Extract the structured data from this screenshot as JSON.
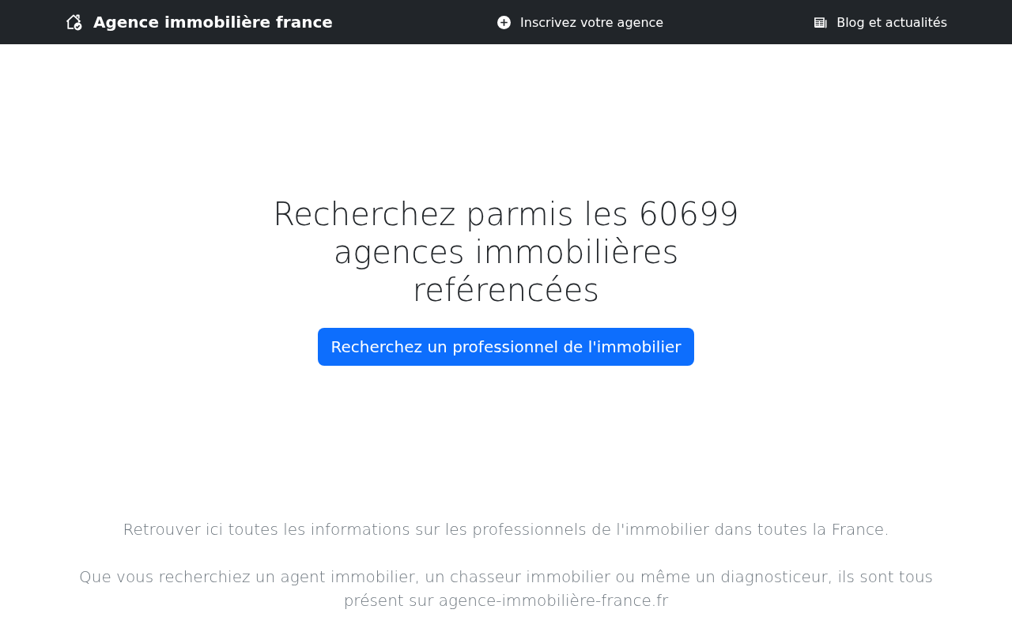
{
  "navbar": {
    "brand": "Agence immobilière france",
    "links": [
      {
        "label": "Inscrivez votre agence",
        "kind": "add"
      },
      {
        "label": "Blog et actualités",
        "kind": "news"
      }
    ]
  },
  "hero": {
    "heading": "Recherchez parmis les 60699 agences immobilières reférencées",
    "button": "Recherchez un professionnel de l'immobilier"
  },
  "intro": [
    "Retrouver ici toutes les informations sur les professionnels de l'immobilier dans toutes la France.",
    "Que vous recherchiez un agent immobilier, un chasseur immobilier ou même un diagnosticeur, ils sont tous présent sur agence-immobilière-france.fr"
  ]
}
